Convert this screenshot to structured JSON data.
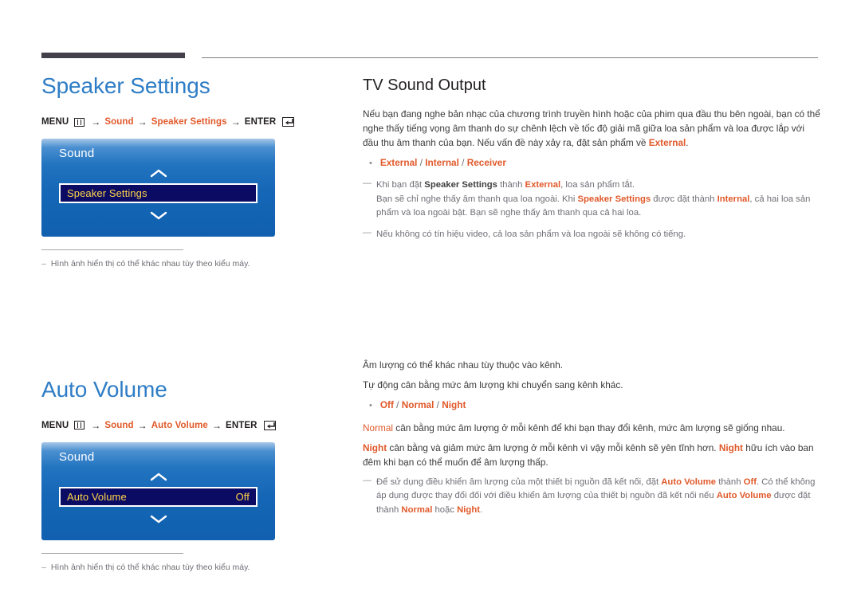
{
  "colors": {
    "heading_blue": "#2e7dc6",
    "accent_orange": "#e0592a",
    "osd_blue": "#1566b6",
    "osd_selected_bg": "#0b0b63",
    "osd_selected_text": "#ffd54a",
    "rule_dark": "#44404b"
  },
  "left": {
    "section1": {
      "title": "Speaker Settings",
      "menu_path": {
        "menu_label": "MENU",
        "arrow": "→",
        "step1": "Sound",
        "step2": "Speaker Settings",
        "enter_label": "ENTER"
      },
      "osd": {
        "title": "Sound",
        "row_label": "Speaker Settings",
        "row_value": ""
      },
      "footnote": {
        "dash": "–",
        "text": "Hình ảnh hiển thị có thể khác nhau tùy theo kiểu máy."
      }
    },
    "section2": {
      "title": "Auto Volume",
      "menu_path": {
        "menu_label": "MENU",
        "arrow": "→",
        "step1": "Sound",
        "step2": "Auto Volume",
        "enter_label": "ENTER"
      },
      "osd": {
        "title": "Sound",
        "row_label": "Auto Volume",
        "row_value": "Off"
      },
      "footnote": {
        "dash": "–",
        "text": "Hình ảnh hiển thị có thể khác nhau tùy theo kiểu máy."
      }
    }
  },
  "right": {
    "tv_sound_output": {
      "title": "TV Sound Output",
      "intro_a": "Nếu bạn đang nghe bản nhạc của chương trình truyền hình hoặc của phim qua đầu thu bên ngoài, bạn có thể nghe thấy tiếng vọng âm thanh do sự chênh lệch về tốc độ giải mã giữa loa sản phẩm và loa được lắp với đầu thu âm thanh của bạn. Nếu vấn đề này xảy ra, đặt sản phẩm về ",
      "intro_a_hl": "External",
      "intro_a_end": ".",
      "options": [
        "External",
        "Internal",
        "Receiver"
      ],
      "option_sep": " / ",
      "note1_p1": "Khi bạn đặt ",
      "note1_b1": "Speaker Settings",
      "note1_p2": " thành ",
      "note1_b2": "External",
      "note1_p3": ", loa sản phẩm tắt.",
      "note1_p4": "Bạn sẽ chỉ nghe thấy âm thanh qua loa ngoài. Khi ",
      "note1_b3": "Speaker Settings",
      "note1_p5": " được đặt thành ",
      "note1_b4": "Internal",
      "note1_p6": ", cả hai loa sản phẩm và loa ngoài bật. Bạn sẽ nghe thấy âm thanh qua cả hai loa.",
      "note2": "Nếu không có tín hiệu video, cả loa sản phẩm và loa ngoài sẽ không có tiếng."
    },
    "auto_volume": {
      "p1": "Âm lượng có thể khác nhau tùy thuộc vào kênh.",
      "p2": "Tự động cân bằng mức âm lượng khi chuyển sang kênh khác.",
      "options": [
        "Off",
        "Normal",
        "Night"
      ],
      "option_sep": " / ",
      "p3_b": "Normal",
      "p3": " cân bằng mức âm lượng ở mỗi kênh để khi bạn thay đổi kênh, mức âm lượng sẽ giống nhau.",
      "p4_b1": "Night",
      "p4_a": " cân bằng và giảm mức âm lượng ở mỗi kênh vì vậy mỗi kênh sẽ yên tĩnh hơn. ",
      "p4_b2": "Night",
      "p4_b": " hữu ích vào ban đêm khi bạn có thể muốn để âm lượng thấp.",
      "note1_p1": "Để sử dụng điều khiển âm lượng của một thiết bị nguồn đã kết nối, đặt ",
      "note1_b1": "Auto Volume",
      "note1_p2": " thành ",
      "note1_b2": "Off",
      "note1_p3": ". Có thể không áp dụng được thay đổi đối với điều khiển âm lượng của thiết bị nguồn đã kết nối nếu ",
      "note1_b3": "Auto Volume",
      "note1_p4": " được đặt thành ",
      "note1_b4": "Normal",
      "note1_p5": " hoặc ",
      "note1_b5": "Night",
      "note1_p6": "."
    }
  }
}
